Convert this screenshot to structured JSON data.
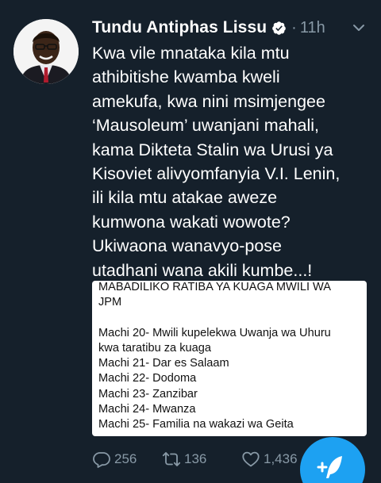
{
  "tweet": {
    "author_name": "Tundu Antiphas Lissu",
    "separator": "·",
    "time": "11h",
    "text_lines": [
      "Kwa vile mnataka kila mtu",
      "athibitishe kwamba kweli",
      "amekufa, kwa nini msimjengee",
      "‘Mausoleum’ uwanjani mahali,",
      "kama Dikteta Stalin wa Urusi ya",
      "Kisoviet alivyomfanyia V.I. Lenin,",
      "ili kila mtu atakae aweze",
      "kumwona wakati wowote?",
      "Ukiwaona wanavyo-pose",
      "utadhani wana akili kumbe...!"
    ]
  },
  "card": {
    "title_line1": "MABADILIKO RATIBA YA KUAGA MWILI WA",
    "title_line2": "JPM",
    "lines": [
      "Machi 20- Mwili kupelekwa Uwanja wa Uhuru",
      "kwa taratibu za kuaga",
      "Machi 21- Dar es Salaam",
      "Machi 22- Dodoma",
      "Machi 23- Zanzibar",
      "Machi 24- Mwanza",
      "Machi 25- Familia na wakazi wa Geita"
    ]
  },
  "actions": {
    "replies": "256",
    "retweets": "136",
    "likes": "1,436"
  },
  "colors": {
    "background": "#15202b",
    "secondary_text": "#8899a6",
    "accent": "#1da1f2"
  },
  "icons": {
    "verified": "verified-badge-icon",
    "caret": "chevron-down-icon",
    "reply": "reply-icon",
    "retweet": "retweet-icon",
    "like": "heart-icon",
    "compose": "compose-tweet-icon"
  }
}
